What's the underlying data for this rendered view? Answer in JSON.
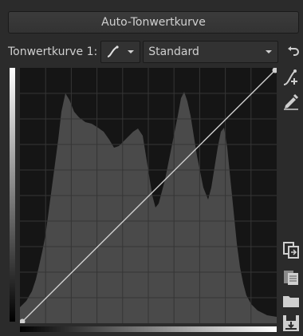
{
  "header": {
    "auto_curve_button": "Auto-Tonwertkurve"
  },
  "curve_row": {
    "label": "Tonwertkurve 1:",
    "mode_select_value": "Standard"
  },
  "icons": {
    "curve_type": "curve-icon",
    "dropdown": "chevron-down-icon",
    "undo": "undo-icon",
    "edit_points": "edit-points-icon",
    "picker": "color-picker-icon",
    "copy": "copy-icon",
    "paste": "paste-icon",
    "open": "folder-icon",
    "save": "save-icon"
  },
  "colors": {
    "histogram": "#4a4a4a",
    "grid": "#353535",
    "curve": "#d0d0d0",
    "background": "#2b2b2b"
  }
}
